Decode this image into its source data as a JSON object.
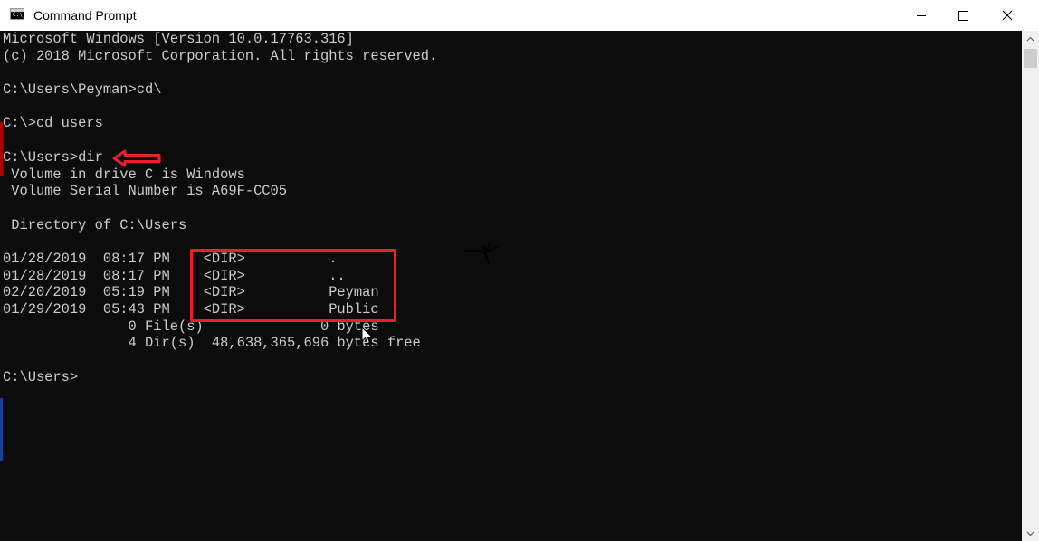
{
  "window": {
    "title": "Command Prompt",
    "icon_text": "C:\\_"
  },
  "console": {
    "lines": [
      "Microsoft Windows [Version 10.0.17763.316]",
      "(c) 2018 Microsoft Corporation. All rights reserved.",
      "",
      "C:\\Users\\Peyman>cd\\",
      "",
      "C:\\>cd users",
      "",
      "C:\\Users>dir",
      " Volume in drive C is Windows",
      " Volume Serial Number is A69F-CC05",
      "",
      " Directory of C:\\Users",
      "",
      "01/28/2019  08:17 PM    <DIR>          .",
      "01/28/2019  08:17 PM    <DIR>          ..",
      "02/20/2019  05:19 PM    <DIR>          Peyman",
      "01/29/2019  05:43 PM    <DIR>          Public",
      "               0 File(s)              0 bytes",
      "               4 Dir(s)  48,638,365,696 bytes free",
      "",
      "C:\\Users>"
    ]
  },
  "colors": {
    "console_bg": "#0c0c0c",
    "console_text": "#cccccc",
    "annotation": "#e8202a"
  },
  "icons": {
    "minimize": "minimize-icon",
    "maximize": "maximize-icon",
    "close": "close-icon",
    "scroll_up": "scroll-up-arrow-icon",
    "scroll_down": "scroll-down-arrow-icon",
    "annotation_arrow": "left-arrow-icon",
    "cursor": "mouse-cursor-icon"
  }
}
